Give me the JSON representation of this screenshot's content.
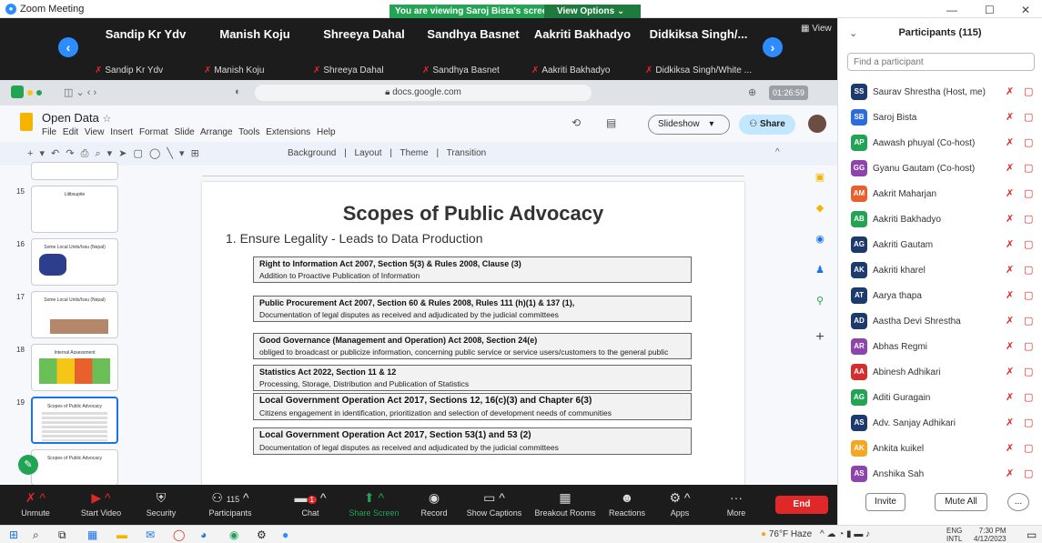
{
  "window": {
    "title": "Zoom Meeting",
    "viewing_banner": "You are viewing Saroj Bista's screen",
    "view_options": "View Options"
  },
  "video_strip": {
    "view_label": "View",
    "tiles": [
      {
        "name": "Sandip Kr Ydv",
        "sub": "Sandip Kr Ydv"
      },
      {
        "name": "Manish Koju",
        "sub": "Manish Koju"
      },
      {
        "name": "Shreeya Dahal",
        "sub": "Shreeya Dahal"
      },
      {
        "name": "Sandhya Basnet",
        "sub": "Sandhya Basnet"
      },
      {
        "name": "Aakriti Bakhadyo",
        "sub": "Aakriti Bakhadyo"
      },
      {
        "name": "Didkiksa Singh/...",
        "sub": "Didkiksa Singh/White ..."
      }
    ]
  },
  "browser": {
    "url": "docs.google.com",
    "timer": "01:26:59"
  },
  "doc": {
    "title": "Open Data",
    "menus": [
      "File",
      "Edit",
      "View",
      "Insert",
      "Format",
      "Slide",
      "Arrange",
      "Tools",
      "Extensions",
      "Help"
    ],
    "slideshow": "Slideshow",
    "share": "Share",
    "toolbar": [
      "Background",
      "Layout",
      "Theme",
      "Transition"
    ]
  },
  "filmstrip": [
    {
      "num": "15",
      "title": "Litibsupite"
    },
    {
      "num": "16",
      "title": "Some Local Units/Issu (Nepal)"
    },
    {
      "num": "17",
      "title": "Some Local Units/Issu (Nepal)"
    },
    {
      "num": "18",
      "title": "Internal Assessment"
    },
    {
      "num": "19",
      "title": "Scopes of Public Advocacy"
    },
    {
      "num": "",
      "title": "Scopes of Public Advocacy"
    }
  ],
  "slide": {
    "title": "Scopes of Public Advocacy",
    "point": "1.   Ensure Legality - Leads to Data Production",
    "laws": [
      {
        "title": "Right to Information Act 2007, Section 5(3) & Rules 2008, Clause (3)",
        "desc": "Addition to Proactive Publication of Information"
      },
      {
        "title": "Public Procurement Act 2007, Section 60 & Rules 2008, Rules 111 (h)(1) & 137 (1),",
        "desc": "Documentation of legal disputes as received and adjudicated by the judicial committees"
      },
      {
        "title": "Good Governance (Management and Operation) Act 2008, Section 24(e)",
        "desc": "obliged to broadcast or publicize information, concerning public service or service users/customers to the general public"
      },
      {
        "title": "Statistics Act 2022, Section 11 & 12",
        "desc": "Processing, Storage, Distribution and Publication of Statistics"
      },
      {
        "title": "Local Government Operation Act 2017, Sections 12, 16(c)(3) and Chapter 6(3)",
        "desc": "Citizens engagement in identification, prioritization and selection of development needs of communities"
      },
      {
        "title": "Local Government Operation Act 2017, Section 53(1) and 53 (2)",
        "desc": "Documentation of legal disputes as received and adjudicated by the judicial committees"
      }
    ]
  },
  "controls": {
    "items": [
      {
        "label": "Unmute",
        "icon": "mic-off-icon"
      },
      {
        "label": "Start Video",
        "icon": "video-off-icon"
      },
      {
        "label": "Security",
        "icon": "shield-icon"
      },
      {
        "label": "Participants",
        "icon": "participants-icon",
        "badge": "115"
      },
      {
        "label": "Chat",
        "icon": "chat-icon",
        "badge": "1"
      },
      {
        "label": "Share Screen",
        "icon": "share-screen-icon"
      },
      {
        "label": "Record",
        "icon": "record-icon"
      },
      {
        "label": "Show Captions",
        "icon": "captions-icon"
      },
      {
        "label": "Breakout Rooms",
        "icon": "breakout-icon"
      },
      {
        "label": "Reactions",
        "icon": "reactions-icon"
      },
      {
        "label": "Apps",
        "icon": "apps-icon"
      },
      {
        "label": "More",
        "icon": "more-icon"
      }
    ],
    "end": "End"
  },
  "participants": {
    "title": "Participants (115)",
    "search_placeholder": "Find a participant",
    "list": [
      {
        "initials": "SS",
        "name": "Saurav Shrestha (Host, me)",
        "color": "#1d3a6e"
      },
      {
        "initials": "SB",
        "name": "Saroj Bista",
        "color": "#2d6cdf"
      },
      {
        "initials": "AP",
        "name": "Aawash phuyal (Co-host)",
        "color": "#23a455"
      },
      {
        "initials": "GG",
        "name": "Gyanu Gautam (Co-host)",
        "color": "#8e44ad"
      },
      {
        "initials": "AM",
        "name": "Aakrit Maharjan",
        "color": "#e8602c"
      },
      {
        "initials": "AB",
        "name": "Aakriti Bakhadyo",
        "color": "#23a455"
      },
      {
        "initials": "AG",
        "name": "Aakriti Gautam",
        "color": "#1d3a6e"
      },
      {
        "initials": "AK",
        "name": "Aakriti kharel",
        "color": "#1d3a6e"
      },
      {
        "initials": "AT",
        "name": "Aarya thapa",
        "color": "#1d3a6e"
      },
      {
        "initials": "AD",
        "name": "Aastha Devi Shrestha",
        "color": "#1d3a6e"
      },
      {
        "initials": "AR",
        "name": "Abhas Regmi",
        "color": "#8e44ad"
      },
      {
        "initials": "AA",
        "name": "Abinesh Adhikari",
        "color": "#d32f2f"
      },
      {
        "initials": "AG",
        "name": "Aditi Guragain",
        "color": "#23a455"
      },
      {
        "initials": "AS",
        "name": "Adv. Sanjay Adhikari",
        "color": "#1d3a6e"
      },
      {
        "initials": "AK",
        "name": "Ankita kuikel",
        "color": "#f5a623"
      },
      {
        "initials": "AS",
        "name": "Anshika Sah",
        "color": "#8e44ad"
      }
    ],
    "invite": "Invite",
    "mute_all": "Mute All",
    "more": "..."
  },
  "taskbar": {
    "weather": "76°F Haze",
    "lang1": "ENG",
    "lang2": "INTL",
    "time": "7:30 PM",
    "date": "4/12/2023"
  }
}
